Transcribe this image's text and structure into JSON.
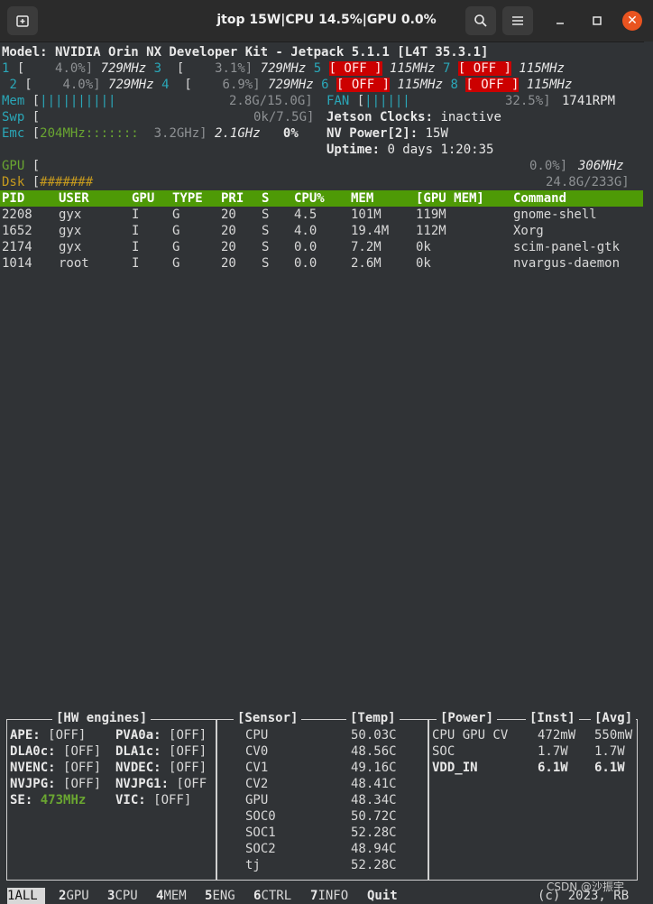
{
  "window": {
    "title": "jtop 15W|CPU 14.5%|GPU 0.0%",
    "icons": {
      "new_tab": "new-tab-icon",
      "search": "search-icon",
      "menu": "hamburger-menu-icon",
      "minimize": "minimize-icon",
      "maximize": "maximize-icon",
      "close": "close-icon"
    }
  },
  "model_line": "Model: NVIDIA Orin NX Developer Kit - Jetpack 5.1.1 [L4T 35.3.1]",
  "cpus": [
    {
      "id": "1",
      "usage": "4.0%]",
      "freq": "729MHz"
    },
    {
      "id": "2",
      "usage": "4.0%]",
      "freq": "729MHz"
    },
    {
      "id": "3",
      "usage": "3.1%]",
      "freq": "729MHz"
    },
    {
      "id": "4",
      "usage": "6.9%]",
      "freq": "729MHz"
    },
    {
      "id": "5",
      "state": " OFF ",
      "freq": "115MHz"
    },
    {
      "id": "6",
      "state": " OFF ",
      "freq": "115MHz"
    },
    {
      "id": "7",
      "state": " OFF ",
      "freq": "115MHz"
    },
    {
      "id": "8",
      "state": " OFF ",
      "freq": "115MHz"
    }
  ],
  "mem": {
    "label": "Mem",
    "bars": "||||||||||",
    "value": "2.8G/15.0G]"
  },
  "swp": {
    "label": "Swp",
    "value": "0k/7.5G]"
  },
  "emc": {
    "label": "Emc",
    "freq_bar": "204MHz:::::::",
    "max": "3.2GHz]",
    "cur": "2.1GHz",
    "pct": "0%"
  },
  "fan": {
    "label": "FAN",
    "bars": "||||||",
    "pct": "32.5%]",
    "rpm": "1741RPM"
  },
  "jetson_clocks": {
    "label": "Jetson Clocks:",
    "value": "inactive"
  },
  "nv_power": {
    "label": "NV Power[2]:",
    "value": "15W"
  },
  "uptime": {
    "label": "Uptime:",
    "value": "0 days 1:20:35"
  },
  "gpu": {
    "label": "GPU",
    "pct": "0.0%]",
    "freq": "306MHz"
  },
  "dsk": {
    "label": "Dsk",
    "bars": "#######",
    "value": "24.8G/233G]"
  },
  "process_table": {
    "headers": [
      "PID",
      "USER",
      "GPU",
      "TYPE",
      "PRI",
      "S",
      "CPU%",
      "MEM",
      "[GPU MEM]",
      "Command"
    ],
    "rows": [
      [
        "2208",
        "gyx",
        "I",
        "G",
        "20",
        "S",
        "4.5",
        "101M",
        "119M",
        "gnome-shell"
      ],
      [
        "1652",
        "gyx",
        "I",
        "G",
        "20",
        "S",
        "4.0",
        "19.4M",
        "112M",
        "Xorg"
      ],
      [
        "2174",
        "gyx",
        "I",
        "G",
        "20",
        "S",
        "0.0",
        "7.2M",
        "0k",
        "scim-panel-gtk"
      ],
      [
        "1014",
        "root",
        "I",
        "G",
        "20",
        "S",
        "0.0",
        "2.6M",
        "0k",
        "nvargus-daemon"
      ]
    ]
  },
  "hw_engines": {
    "title": "[HW engines]",
    "rows": [
      [
        {
          "name": "APE:",
          "value": "[OFF]"
        },
        {
          "name": "PVA0a:",
          "value": "[OFF]"
        }
      ],
      [
        {
          "name": "DLA0c:",
          "value": "[OFF]"
        },
        {
          "name": "DLA1c:",
          "value": "[OFF]"
        }
      ],
      [
        {
          "name": "NVENC:",
          "value": "[OFF]"
        },
        {
          "name": "NVDEC:",
          "value": "[OFF]"
        }
      ],
      [
        {
          "name": "NVJPG:",
          "value": "[OFF]"
        },
        {
          "name": "NVJPG1:",
          "value": "[OFF"
        }
      ],
      [
        {
          "name": "SE:",
          "value": "473MHz"
        },
        {
          "name": "VIC:",
          "value": "[OFF]"
        }
      ]
    ]
  },
  "sensors": {
    "title_sensor": "[Sensor]",
    "title_temp": "[Temp]",
    "rows": [
      [
        "CPU",
        "50.03C"
      ],
      [
        "CV0",
        "48.56C"
      ],
      [
        "CV1",
        "49.16C"
      ],
      [
        "CV2",
        "48.41C"
      ],
      [
        "GPU",
        "48.34C"
      ],
      [
        "SOC0",
        "50.72C"
      ],
      [
        "SOC1",
        "52.28C"
      ],
      [
        "SOC2",
        "48.94C"
      ],
      [
        "tj",
        "52.28C"
      ]
    ]
  },
  "power": {
    "title_power": "[Power]",
    "title_inst": "[Inst]",
    "title_avg": "[Avg]",
    "rows": [
      [
        "CPU GPU CV",
        "472mW",
        "550mW"
      ],
      [
        "SOC",
        "1.7W",
        "1.7W"
      ],
      [
        "VDD_IN",
        "6.1W",
        "6.1W"
      ]
    ]
  },
  "tabs": [
    {
      "num": "1",
      "label": "ALL"
    },
    {
      "num": "2",
      "label": "GPU"
    },
    {
      "num": "3",
      "label": "CPU"
    },
    {
      "num": "4",
      "label": "MEM"
    },
    {
      "num": "5",
      "label": "ENG"
    },
    {
      "num": "6",
      "label": "CTRL"
    },
    {
      "num": "7",
      "label": "INFO"
    },
    {
      "num": "",
      "label": "Quit"
    }
  ],
  "footer": "(c) 2023, RB",
  "watermark": "CSDN @沙振宇",
  "colors": {
    "header_green": "#4e9a06",
    "off_red": "#cc0000",
    "cyan": "#2aa7b8",
    "close_orange": "#e95420"
  }
}
